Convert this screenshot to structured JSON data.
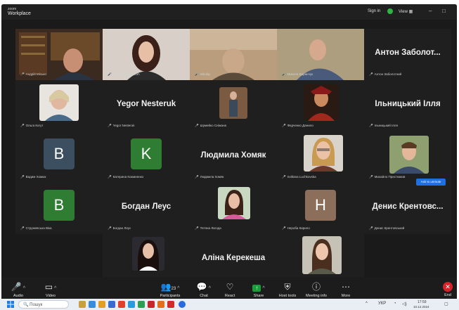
{
  "titlebar": {
    "brand_small": "zoom",
    "brand": "Workplace",
    "signin": "Sign in",
    "view": "View",
    "minimize": "–",
    "maximize": "□",
    "close": "✕"
  },
  "participants": [
    {
      "name": "Андрій Місько",
      "big": "",
      "kind": "video",
      "speaking": true
    },
    {
      "name": "Anastasiia Ploskoh",
      "big": "",
      "kind": "video"
    },
    {
      "name": "Nikolay",
      "big": "",
      "kind": "video"
    },
    {
      "name": "Микола Баранчук",
      "big": "",
      "kind": "video"
    },
    {
      "name": "Антон Заболотний",
      "big": "Антон Заболот...",
      "kind": "name"
    },
    {
      "name": "Ольга Когут",
      "big": "",
      "kind": "photo"
    },
    {
      "name": "Yegor Nesteruk",
      "big": "Yegor Nesteruk",
      "kind": "name"
    },
    {
      "name": "Шумейко Сніжана",
      "big": "",
      "kind": "photo"
    },
    {
      "name": "Федченко Данило",
      "big": "",
      "kind": "photo"
    },
    {
      "name": "Ільницький Ілля",
      "big": "Ільницький Ілля",
      "kind": "name"
    },
    {
      "name": "Вадим Хомюк",
      "big": "",
      "kind": "avatar",
      "letter": "B",
      "color": "#3c4f60"
    },
    {
      "name": "Катерина Коминенко",
      "big": "",
      "kind": "avatar",
      "letter": "K",
      "color": "#2f7d32"
    },
    {
      "name": "Людмила Хомяк",
      "big": "Людмила Хомяк",
      "kind": "name"
    },
    {
      "name": "Svitlana Luchkovska",
      "big": "",
      "kind": "photo"
    },
    {
      "name": "Михайло Пристюмов",
      "big": "",
      "kind": "photo"
    },
    {
      "name": "Стружевська Віка",
      "big": "",
      "kind": "avatar",
      "letter": "B",
      "color": "#2f7d32"
    },
    {
      "name": "Богдан Леус",
      "big": "Богдан Леус",
      "kind": "name"
    },
    {
      "name": "Тетяна Лагода",
      "big": "",
      "kind": "photo"
    },
    {
      "name": "Нероба Кирило",
      "big": "",
      "kind": "avatar",
      "letter": "H",
      "color": "#8c6f5b"
    },
    {
      "name": "Денис Крентовський",
      "big": "Денис Крентовс...",
      "kind": "name"
    },
    {
      "name": "Анастасія Бородій",
      "big": "",
      "kind": "photo"
    },
    {
      "name": "Аліна Керекеша",
      "big": "Аліна Керекеша",
      "kind": "name"
    },
    {
      "name": "Богдана Абраменко",
      "big": "",
      "kind": "photo"
    }
  ],
  "ask_button": "Ask to unmute",
  "toolbar": {
    "audio": "Audio",
    "video": "Video",
    "participants": "Participants",
    "participants_count": "23",
    "chat": "Chat",
    "react": "React",
    "share": "Share",
    "host_tools": "Host tools",
    "meeting_info": "Meeting info",
    "more": "More",
    "end": "End"
  },
  "taskbar": {
    "search_placeholder": "Пошук",
    "lang": "УКР",
    "time": "17:59",
    "date": "10.12.2024"
  },
  "colors": {
    "speaking": "#23d160",
    "mute": "#e0383e",
    "end": "#d8232a",
    "accent": "#1e6fe0"
  }
}
